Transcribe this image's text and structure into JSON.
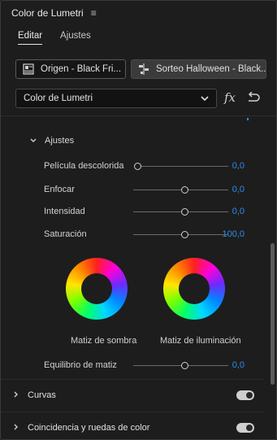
{
  "panel": {
    "title": "Color de Lumetri",
    "menu_icon": "hamburger-menu-icon"
  },
  "tabs": [
    {
      "label": "Editar",
      "active": true
    },
    {
      "label": "Ajustes",
      "active": false
    }
  ],
  "clips": {
    "source": {
      "label": "Origen - Black Fri...",
      "icon": "clip-icon"
    },
    "sequence": {
      "label": "Sorteo Halloween - Black...",
      "icon": "sequence-icon"
    }
  },
  "effect": {
    "selected": "Color de Lumetri"
  },
  "section": {
    "title": "Ajustes",
    "sliders": [
      {
        "label": "Película descolorida",
        "value": "0,0",
        "position": 0.0
      },
      {
        "label": "Enfocar",
        "value": "0,0",
        "position": 0.5
      },
      {
        "label": "Intensidad",
        "value": "0,0",
        "position": 0.5
      },
      {
        "label": "Saturación",
        "value": "100,0",
        "position": 0.5
      }
    ],
    "wheels": [
      {
        "label": "Matiz de sombra"
      },
      {
        "label": "Matiz de iluminación"
      }
    ],
    "balance": {
      "label": "Equilibrio de matiz",
      "value": "0,0",
      "position": 0.5
    }
  },
  "collapsed_sections": [
    {
      "label": "Curvas",
      "enabled": true
    },
    {
      "label": "Coincidencia y ruedas de color",
      "enabled": true
    }
  ],
  "colors": {
    "accent": "#2d8ceb",
    "background": "#1d1d1d"
  }
}
